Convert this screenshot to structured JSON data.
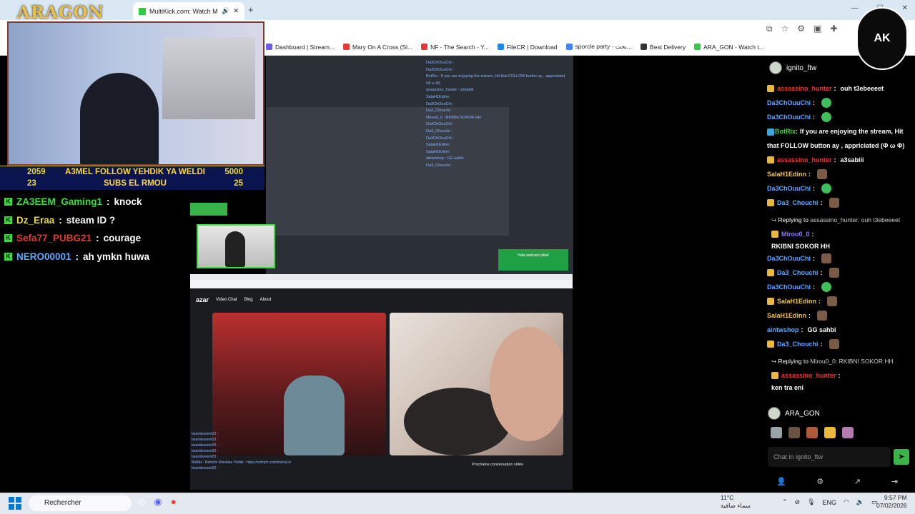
{
  "browser": {
    "active_tab_title": "MultiKick.com: Watch Multiple...",
    "new_tab_label": "+",
    "window_controls": [
      "—",
      "☐",
      "✕"
    ],
    "bookmarks": [
      {
        "label": "Dashboard | Stream...",
        "color": "#6c5ce7"
      },
      {
        "label": "Mary On A Cross (Sl...",
        "color": "#e53935"
      },
      {
        "label": "NF - The Search - Y...",
        "color": "#e53935"
      },
      {
        "label": "FileCR | Download",
        "color": "#1e88e5"
      },
      {
        "label": "sporcle party - بحث...",
        "color": "#4285f4"
      },
      {
        "label": "Best Delivery",
        "color": "#333333"
      },
      {
        "label": "ARA_GON - Watch t...",
        "color": "#2ecc40"
      }
    ]
  },
  "overlay": {
    "logo": "ARAGON",
    "goal_row1": {
      "left": "2059",
      "text": "A3MEL FOLLOW YEHDIK YA WELDI",
      "right": "5000"
    },
    "goal_row2": {
      "left": "23",
      "text": "SUBS EL RMOU",
      "right": "25"
    },
    "chat": [
      {
        "user": "ZA3EEM_Gaming1",
        "color": "#3bdc3b",
        "msg": "knock"
      },
      {
        "user": "Dz_Eraa",
        "color": "#e8d74b",
        "msg": "steam ID ?"
      },
      {
        "user": "Sefa77_PUBG21",
        "color": "#e53935",
        "msg": "courage"
      },
      {
        "user": "NERO00001",
        "color": "#5fa8ff",
        "msg": "ah ymkn huwa"
      }
    ]
  },
  "capture": {
    "chat_lines": [
      "Da3ChOuuChi :",
      "Da3ChOuuChi :",
      "BotRix : If you are enjoying the stream, Hit that FOLLOW button ay , appriciated",
      "(Φ ω Φ)",
      "assassino_hunter : a3sabiii",
      "SalaH1Edinn :",
      "Da3ChOuuChi :",
      "Da3_Chouchi :",
      "Miruo0_0 : RKIBNI SOKOR HH",
      "Da3ChOuuChi :",
      "Da3_Chouchi :",
      "Da3ChOuuChi :",
      "SalaH1Edinn :",
      "SalaH1Edinn :",
      "aintwshop : GG sahbi",
      "Da3_Chouchi :"
    ],
    "green_box_text": "Yalla webcam jdida!",
    "azar_logo": "azar",
    "azar_nav": [
      "Video Chat",
      "Blog",
      "About"
    ],
    "azar_next": "Prochaine conversation vidéo",
    "azar_chat_lines": [
      "beamboesmi23 :",
      "beamboesmi23 :",
      "beamboesmi23 :",
      "beamboesmi23 :",
      "beamboesmi23 :",
      "BotRix : Refetch Rmsblue Profile : https://refetch.com/trivinal.in",
      "beamboesmi23 :"
    ]
  },
  "chat_panel": {
    "channel": "ignito_ftw",
    "messages": [
      {
        "user": "assassino_hunter",
        "color": "#e53935",
        "msg": "ouh t3ebeeeet",
        "badge": "#e8b93a"
      },
      {
        "user": "Da3ChOuuChi",
        "color": "#5fa8ff",
        "msg": "",
        "emote": "g"
      },
      {
        "user": "Da3ChOuuChi",
        "color": "#5fa8ff",
        "msg": "",
        "emote": "g"
      },
      {
        "user": "BotRix",
        "color": "#3bdc3b",
        "msg": "If you are enjoying the stream, Hit that FOLLOW button ay , appriciated   (Φ ω Φ)",
        "badge": "#3aa8e0",
        "wrap": true
      },
      {
        "user": "assassino_hunter",
        "color": "#e53935",
        "msg": "a3sabiii",
        "badge": "#e8b93a"
      },
      {
        "user": "SalaH1Edinn",
        "color": "#f0c34f",
        "msg": "",
        "emote": "c"
      },
      {
        "user": "Da3ChOuuChi",
        "color": "#5fa8ff",
        "msg": "",
        "emote": "g"
      },
      {
        "user": "Da3_Chouchi",
        "color": "#5fa8ff",
        "msg": "",
        "emote": "c",
        "badge": "#e8b93a"
      }
    ],
    "reply1": {
      "label": "Replying to",
      "target": "assassino_hunter:",
      "text": "ouh t3ebeeeet",
      "user": "Mirou0_0",
      "msg": "RKIBNI SOKOR HH"
    },
    "messages2": [
      {
        "user": "Da3ChOuuChi",
        "color": "#5fa8ff",
        "msg": "",
        "emote": "c"
      },
      {
        "user": "Da3_Chouchi",
        "color": "#5fa8ff",
        "msg": "",
        "emote": "c",
        "badge": "#e8b93a"
      },
      {
        "user": "Da3ChOuuChi",
        "color": "#5fa8ff",
        "msg": "",
        "emote": "g"
      },
      {
        "user": "SalaH1Edinn",
        "color": "#f0c34f",
        "msg": "",
        "emote": "c",
        "badge": "#e8b93a"
      },
      {
        "user": "SalaH1Edinn",
        "color": "#f0c34f",
        "msg": "",
        "emote": "c"
      },
      {
        "user": "aintwshop",
        "color": "#5fa8ff",
        "msg": "GG sahbi"
      },
      {
        "user": "Da3_Chouchi",
        "color": "#5fa8ff",
        "msg": "",
        "emote": "c",
        "badge": "#e8b93a"
      }
    ],
    "reply2": {
      "label": "Replying to",
      "target": "Mirou0_0:",
      "text": "RKIBNI SOKOR HH",
      "user": "assassino_hunter",
      "msg": "ken tra eni"
    },
    "current_user": "ARA_GON",
    "input_placeholder": "Chat in ignito_ftw",
    "send_icon": "send-icon"
  },
  "taskbar": {
    "search_label": "Rechercher",
    "weather_temp": "11°C",
    "weather_desc": "سماء صافية",
    "language": "ENG",
    "time": "9:57 PM",
    "date": "07/02/2026"
  }
}
